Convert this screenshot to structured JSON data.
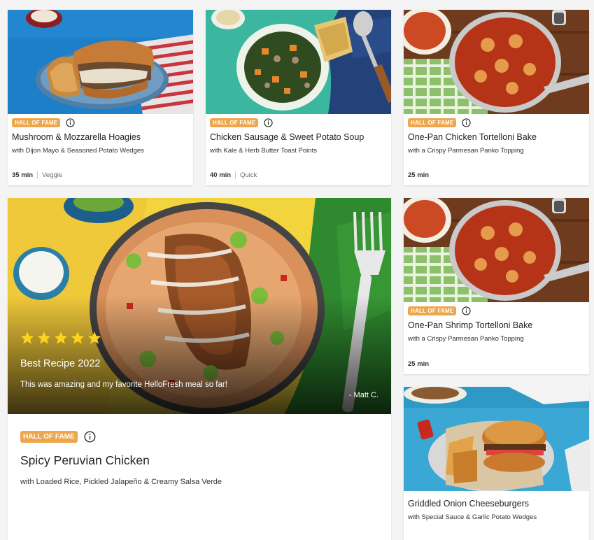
{
  "colors": {
    "badge": "#eea64b",
    "page_bg": "#f4f4f4",
    "star": "#ffd21f"
  },
  "cards": [
    {
      "badge": "HALL OF FAME",
      "title": "Mushroom & Mozzarella Hoagies",
      "subtitle": "with Dijon Mayo & Seasoned Potato Wedges",
      "time": "35 min",
      "tag": "Veggie"
    },
    {
      "badge": "HALL OF FAME",
      "title": "Chicken Sausage & Sweet Potato Soup",
      "subtitle": "with Kale & Herb Butter Toast Points",
      "time": "40 min",
      "tag": "Quick"
    },
    {
      "badge": "HALL OF FAME",
      "title": "One-Pan Chicken Tortelloni Bake",
      "subtitle": "with a Crispy Parmesan Panko Topping",
      "time": "25 min"
    },
    {
      "badge": "HALL OF FAME",
      "title": "One-Pan Shrimp Tortelloni Bake",
      "subtitle": "with a Crispy Parmesan Panko Topping",
      "time": "25 min"
    },
    {
      "title": "Griddled Onion Cheeseburgers",
      "subtitle": "with Special Sauce & Garlic Potato Wedges"
    }
  ],
  "featured": {
    "rating_stars": 5,
    "review_title": "Best Recipe 2022",
    "review_text": "This was amazing and my favorite HelloFresh meal so far!",
    "review_author": "- Matt C.",
    "badge": "HALL OF FAME",
    "title": "Spicy Peruvian Chicken",
    "subtitle": "with Loaded Rice, Pickled Jalapeño & Creamy Salsa Verde"
  }
}
